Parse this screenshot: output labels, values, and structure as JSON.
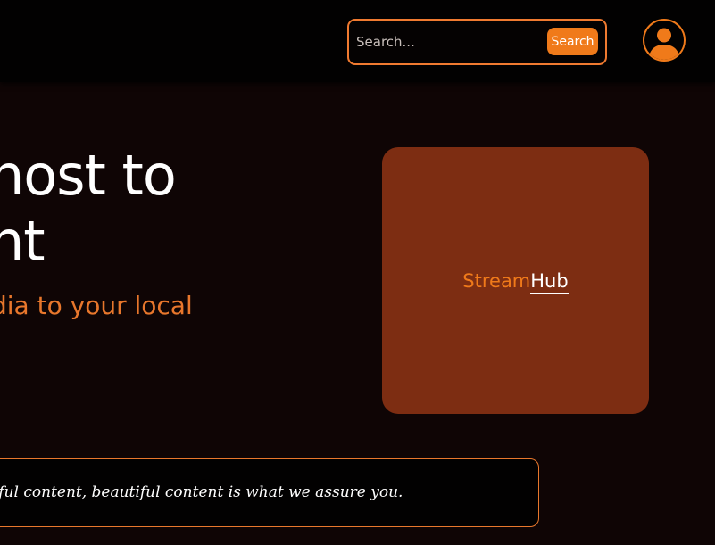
{
  "header": {
    "search": {
      "placeholder": "Search...",
      "value": "",
      "button_label": "Search"
    },
    "avatar_icon": "user-icon"
  },
  "hero": {
    "title_line_1": "nost to",
    "title_line_2": "nt",
    "subtitle": "dia to your local"
  },
  "brand": {
    "part_1": "Stream",
    "part_2": "Hub"
  },
  "tagline": {
    "text": "tiful content, beautiful content is what we assure you."
  },
  "colors": {
    "accent": "#f07a1a",
    "background": "#0f0505",
    "card": "#7d2d12",
    "header": "#020101"
  }
}
